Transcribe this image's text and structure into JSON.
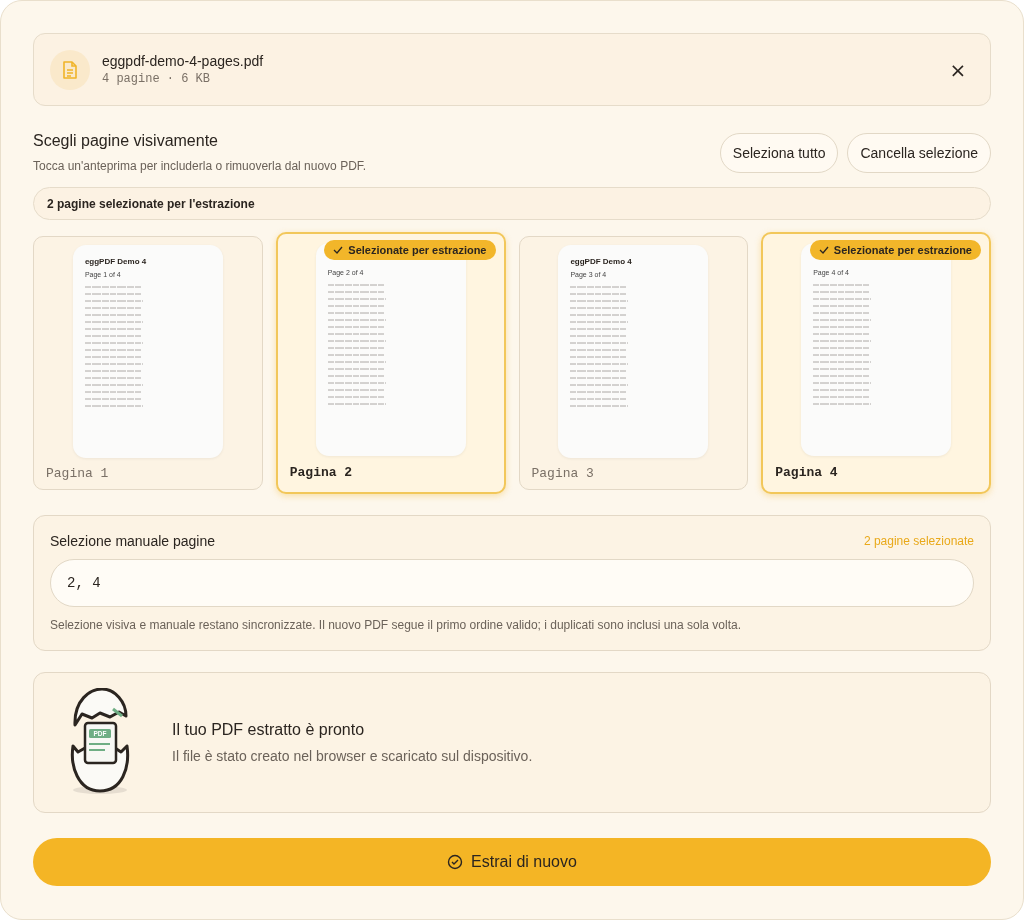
{
  "file": {
    "name": "eggpdf-demo-4-pages.pdf",
    "meta": "4 pagine · 6 KB",
    "close": "×"
  },
  "picker": {
    "title": "Scegli pagine visivamente",
    "hint": "Tocca un'anteprima per includerla o rimuoverla dal nuovo PDF.",
    "buttons": [
      "Seleziona tutto",
      "Cancella selezione"
    ],
    "summary": "2 pagine selezionate per l'estrazione"
  },
  "pages": [
    {
      "label": "Pagina 1",
      "selected": false,
      "doc_title": "eggPDF Demo 4",
      "doc_subtitle": "Page 1 of 4"
    },
    {
      "label": "Pagina 2",
      "selected": true,
      "doc_subtitle": "Page 2 of 4",
      "badge": "Selezionate per estrazione"
    },
    {
      "label": "Pagina 3",
      "selected": false,
      "doc_title": "eggPDF Demo 4",
      "doc_subtitle": "Page 3 of 4"
    },
    {
      "label": "Pagina 4",
      "selected": true,
      "doc_subtitle": "Page 4 of 4",
      "badge": "Selezionate per estrazione"
    }
  ],
  "manual": {
    "title": "Selezione manuale pagine",
    "count": "2 pagine selezionate",
    "value": "2, 4",
    "help": "Selezione visiva e manuale restano sincronizzate. Il nuovo PDF segue il primo ordine valido; i duplicati sono inclusi una sola volta."
  },
  "result": {
    "title": "Il tuo PDF estratto è pronto",
    "text": "Il file è stato creato nel browser e scaricato sul dispositivo.",
    "badge": "PDF"
  },
  "action": {
    "label": "Estrai di nuovo"
  }
}
